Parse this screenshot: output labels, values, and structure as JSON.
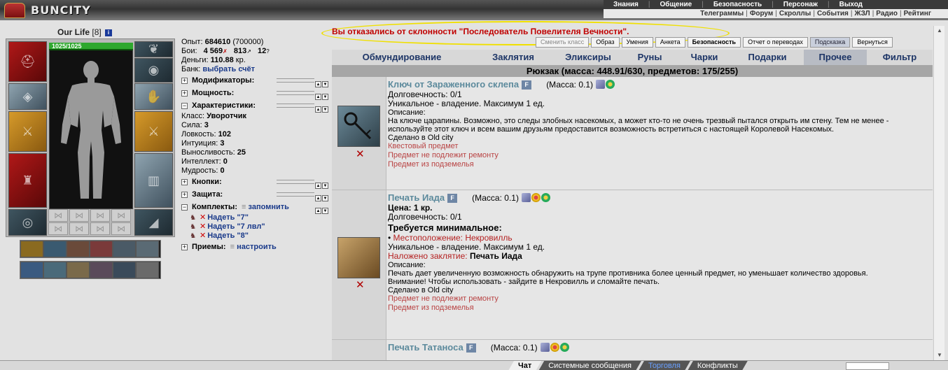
{
  "top": {
    "logo": "BUNCITY",
    "menu_primary": [
      "Знания",
      "Общение",
      "Безопасность",
      "Персонаж",
      "Выход"
    ],
    "menu_secondary": [
      "Телеграммы",
      "Форум",
      "Скроллы",
      "События",
      "ЖЗЛ",
      "Радио",
      "Рейтинг"
    ]
  },
  "character": {
    "name": "Our Life",
    "level": "[8]",
    "info": "i",
    "hp": "1025/1025"
  },
  "stats": {
    "exp_label": "Опыт:",
    "exp_value": "684610",
    "exp_next": "(700000)",
    "fights_label": "Бои:",
    "fights_win": "4 569",
    "fights_lose": "813",
    "fights_draw": "12",
    "money_label": "Деньги:",
    "money_value": "110.88",
    "money_unit": "кр.",
    "bank_label": "Банк:",
    "bank_link": "выбрать счёт",
    "sections": {
      "modifiers": "Модификаторы:",
      "power": "Мощность:",
      "characteristics": "Характеристики:",
      "buttons": "Кнопки:",
      "defense": "Защита:",
      "sets": "Комплекты:",
      "sets_action": "запомнить",
      "techniques": "Приемы:",
      "techniques_action": "настроить"
    },
    "class_label": "Класс:",
    "class_value": "Уворотчик",
    "attributes": [
      {
        "label": "Сила:",
        "value": "3"
      },
      {
        "label": "Ловкость:",
        "value": "102"
      },
      {
        "label": "Интуиция:",
        "value": "3"
      },
      {
        "label": "Выносливость:",
        "value": "25"
      },
      {
        "label": "Интеллект:",
        "value": "0"
      },
      {
        "label": "Мудрость:",
        "value": "0"
      }
    ],
    "set_items": [
      "Надеть \"7\"",
      "Надеть \"7 лвл\"",
      "Надеть \"8\""
    ]
  },
  "notice": "Вы отказались от склонности \"Последователь Повелителя Вечности\".",
  "buttons": {
    "change_class": "Сменить класс",
    "image": "Образ",
    "skills": "Умения",
    "profile": "Анкета",
    "security": "Безопасность",
    "transfers": "Отчет о переводах",
    "hint": "Подсказка",
    "back": "Вернуться"
  },
  "tabs": [
    "Обмундирование",
    "Заклятия",
    "Эликсиры",
    "Руны",
    "Чарки",
    "Подарки",
    "Прочее",
    "Фильтр"
  ],
  "active_tab": "Прочее",
  "backpack": "Рюкзак (масса: 448.91/630, предметов: 175/255)",
  "items": [
    {
      "name": "Ключ от Зараженного склепа",
      "badge": "F",
      "mass": "(Масса: 0.1)",
      "durability": "Долговечность: 0/1",
      "unique": "Уникальное - владение. Максимум 1 ед.",
      "desc_label": "Описание:",
      "desc": "На ключе царапины. Возможно, это следы злобных насекомых, а может кто-то не очень трезвый пытался открыть им стену. Тем не менее - используйте этот ключ и всем вашим друзьям предоставится возможность встретиться с настоящей Королевой Насекомых.",
      "made": "Сделано в Old city",
      "flags": [
        "Квестовый предмет",
        "Предмет не подлежит ремонту",
        "Предмет из подземелья"
      ]
    },
    {
      "name": "Печать Иада",
      "badge": "F",
      "mass": "(Масса: 0.1)",
      "price": "Цена: 1 кр.",
      "durability": "Долговечность: 0/1",
      "req_label": "Требуется минимальное:",
      "req_location": "Местоположение: Некровилль",
      "unique": "Уникальное - владение. Максимум 1 ед.",
      "spell_label": "Наложено заклятие:",
      "spell_value": "Печать Иада",
      "desc_label": "Описание:",
      "desc": "Печать дает увеличенную возможность обнаружить на трупе противника более ценный предмет, но уменьшает количество здоровья.",
      "note": "Внимание! Чтобы использовать - зайдите в Некровилль и сломайте печать.",
      "made": "Сделано в Old city",
      "flags": [
        "Предмет не подлежит ремонту",
        "Предмет из подземелья"
      ]
    },
    {
      "name": "Печать Татаноса",
      "badge": "F",
      "mass": "(Масса: 0.1)"
    }
  ],
  "bottom_tabs": [
    "Чат",
    "Системные сообщения",
    "Торговля",
    "Конфликты"
  ]
}
